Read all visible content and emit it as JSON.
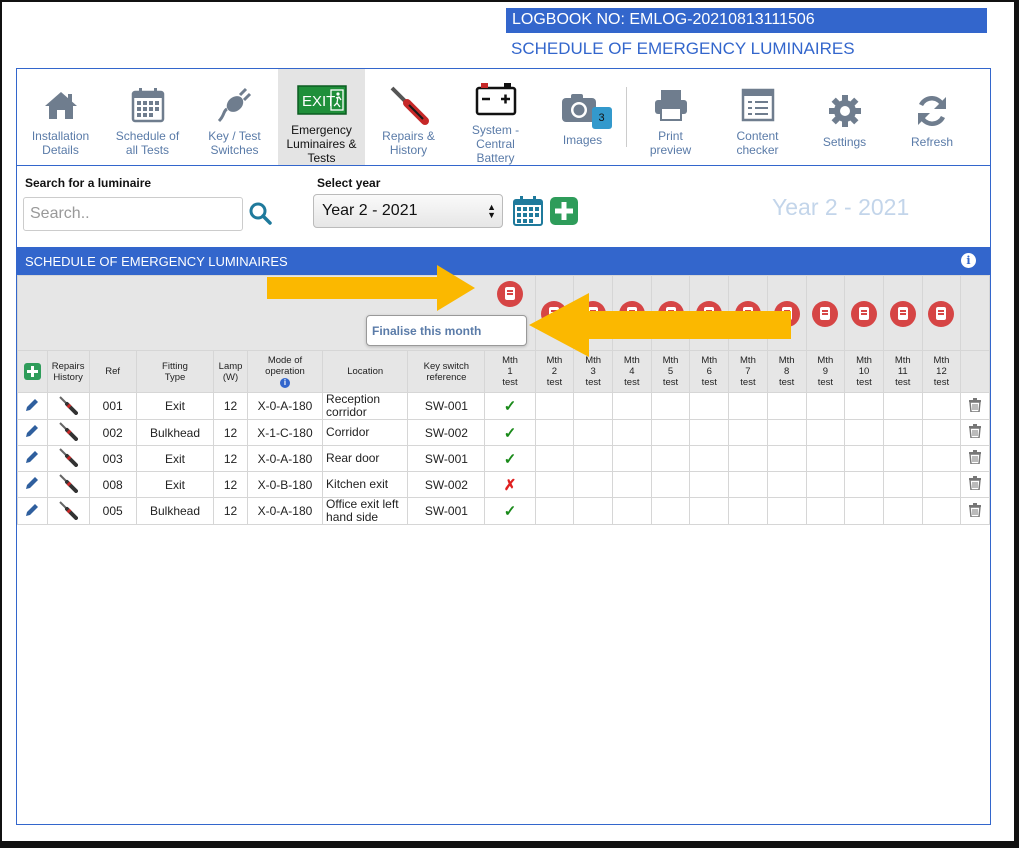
{
  "header": {
    "logbook": "LOGBOOK NO: EMLOG-20210813111506",
    "subtitle": "SCHEDULE OF EMERGENCY LUMINAIRES"
  },
  "toolbar": [
    {
      "key": "installation",
      "label1": "Installation",
      "label2": "Details",
      "icon": "house-icon"
    },
    {
      "key": "schedule",
      "label1": "Schedule of",
      "label2": "all Tests",
      "icon": "calendar-icon"
    },
    {
      "key": "keytest",
      "label1": "Key / Test",
      "label2": "Switches",
      "icon": "plug-icon"
    },
    {
      "key": "emergency",
      "label1": "Emergency",
      "label2": "Luminaires &",
      "label3": "Tests",
      "icon": "exit-sign-icon",
      "active": true,
      "sign": "EXIT"
    },
    {
      "key": "repairs",
      "label1": "Repairs &",
      "label2": "History",
      "icon": "screwdriver-icon"
    },
    {
      "key": "battery",
      "label1": "System -",
      "label2": "Central",
      "label3": "Battery",
      "icon": "battery-icon"
    },
    {
      "key": "images",
      "label1": "Images",
      "icon": "camera-icon",
      "badge": "3"
    },
    {
      "key": "print",
      "label1": "Print",
      "label2": "preview",
      "icon": "printer-icon"
    },
    {
      "key": "content",
      "label1": "Content",
      "label2": "checker",
      "icon": "checklist-icon"
    },
    {
      "key": "settings",
      "label1": "Settings",
      "icon": "gear-icon"
    },
    {
      "key": "refresh",
      "label1": "Refresh",
      "icon": "refresh-icon"
    }
  ],
  "search": {
    "label": "Search for a luminaire",
    "placeholder": "Search.."
  },
  "year": {
    "label": "Select year",
    "selected": "Year 2 - 2021",
    "display": "Year 2 - 2021"
  },
  "schedule": {
    "title": "SCHEDULE OF EMERGENCY LUMINAIRES",
    "info": "i",
    "tooltip": "Finalise this month",
    "columns": {
      "repairs": [
        "Repairs",
        "History"
      ],
      "ref": "Ref",
      "fitting": [
        "Fitting",
        "Type"
      ],
      "lamp": [
        "Lamp",
        "(W)"
      ],
      "mode": [
        "Mode of",
        "operation"
      ],
      "location": "Location",
      "keyswitch": [
        "Key switch",
        "reference"
      ],
      "months": [
        [
          "Mth",
          "1",
          "test"
        ],
        [
          "Mth",
          "2",
          "test"
        ],
        [
          "Mth",
          "3",
          "test"
        ],
        [
          "Mth",
          "4",
          "test"
        ],
        [
          "Mth",
          "5",
          "test"
        ],
        [
          "Mth",
          "6",
          "test"
        ],
        [
          "Mth",
          "7",
          "test"
        ],
        [
          "Mth",
          "8",
          "test"
        ],
        [
          "Mth",
          "9",
          "test"
        ],
        [
          "Mth",
          "10",
          "test"
        ],
        [
          "Mth",
          "11",
          "test"
        ],
        [
          "Mth",
          "12",
          "test"
        ]
      ]
    },
    "rows": [
      {
        "ref": "001",
        "fitting": "Exit",
        "lamp": "12",
        "mode": "X-0-A-180",
        "location": "Reception corridor",
        "keyswitch": "SW-001",
        "m1": "pass"
      },
      {
        "ref": "002",
        "fitting": "Bulkhead",
        "lamp": "12",
        "mode": "X-1-C-180",
        "location": "Corridor",
        "keyswitch": "SW-002",
        "m1": "pass"
      },
      {
        "ref": "003",
        "fitting": "Exit",
        "lamp": "12",
        "mode": "X-0-A-180",
        "location": "Rear door",
        "keyswitch": "SW-001",
        "m1": "pass"
      },
      {
        "ref": "008",
        "fitting": "Exit",
        "lamp": "12",
        "mode": "X-0-B-180",
        "location": "Kitchen exit",
        "keyswitch": "SW-002",
        "m1": "fail"
      },
      {
        "ref": "005",
        "fitting": "Bulkhead",
        "lamp": "12",
        "mode": "X-0-A-180",
        "location": "Office exit left hand side",
        "keyswitch": "SW-001",
        "m1": "pass"
      }
    ],
    "colors": {
      "accent": "#3366cc",
      "pass": "#1a8a1a",
      "fail": "#e02020",
      "arrow": "#fbb800",
      "pdf": "#d64545"
    }
  }
}
